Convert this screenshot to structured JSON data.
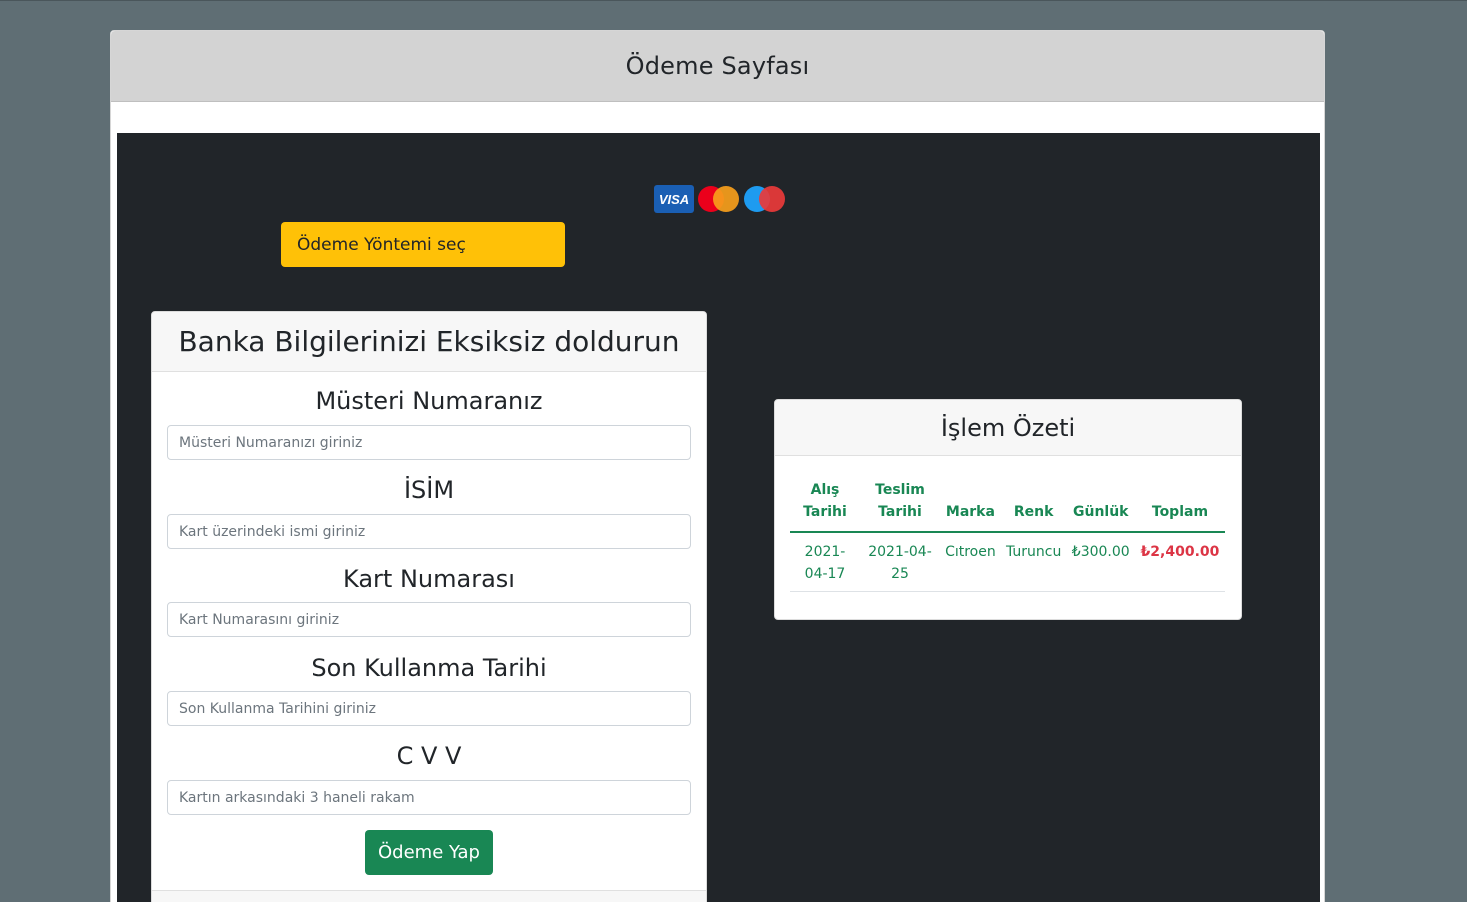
{
  "header": {
    "title": "Ödeme Sayfası"
  },
  "payment_logos": {
    "visa_text": "VISA"
  },
  "method_button": {
    "label": "Ödeme Yöntemi seç"
  },
  "bank_form": {
    "title": "Banka Bilgilerinizi Eksiksiz doldurun",
    "fields": [
      {
        "label": "Müsteri Numaranız",
        "placeholder": "Müsteri Numaranızı giriniz",
        "value": ""
      },
      {
        "label": "İSİM",
        "placeholder": "Kart üzerindeki ismi giriniz",
        "value": ""
      },
      {
        "label": "Kart Numarası",
        "placeholder": "Kart Numarasını giriniz",
        "value": ""
      },
      {
        "label": "Son Kullanma Tarihi",
        "placeholder": "Son Kullanma Tarihini giriniz",
        "value": ""
      },
      {
        "label": "C V V",
        "placeholder": "Kartın arkasındaki 3 haneli rakam",
        "value": ""
      }
    ],
    "submit_label": "Ödeme Yap"
  },
  "summary": {
    "title": "İşlem Özeti",
    "columns": [
      "Alış Tarihi",
      "Teslim Tarihi",
      "Marka",
      "Renk",
      "Günlük",
      "Toplam"
    ],
    "rows": [
      [
        "2021-04-17",
        "2021-04-25",
        "Cıtroen",
        "Turuncu",
        "₺300.00",
        "₺2,400.00"
      ]
    ]
  },
  "colors": {
    "page_bg": "#5f6e74",
    "dark_panel": "#212529",
    "warning": "#ffc107",
    "success": "#198754",
    "danger": "#dc3545"
  }
}
